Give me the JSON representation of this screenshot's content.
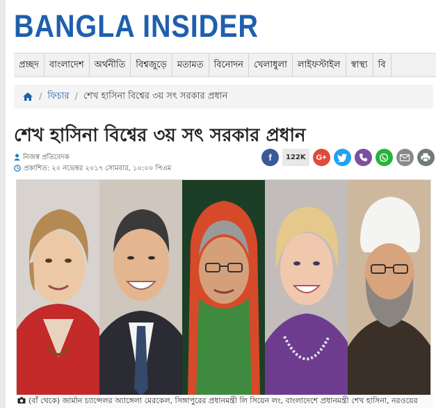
{
  "site": {
    "logo": "BANGLA INSIDER"
  },
  "nav": [
    "প্রচ্ছদ",
    "বাংলাদেশ",
    "অর্থনীতি",
    "বিশ্বজুড়ে",
    "মতামত",
    "বিনোদন",
    "খেলাধুলা",
    "লাইফস্টাইল",
    "স্বাস্থ্য",
    "বি"
  ],
  "breadcrumb": {
    "home_icon": "home-icon",
    "section": "ফিচার",
    "current": "শেখ হাসিনা বিশ্বের ৩য় সৎ সরকার প্রধান"
  },
  "article": {
    "title": "শেখ হাসিনা বিশ্বের ৩য় সৎ সরকার প্রধান",
    "author": "নিজস্ব প্রতিবেদক",
    "published": "প্রকাশিত: ২০ নভেম্বর ২০১৭ সোমবার, ১০:০০ পিএম",
    "caption": "(বাঁ থেকে) জার্মান চ্যান্সেলর অ্যাঙ্গেলা মেরকেল, সিঙ্গাপুরের প্রধানমন্ত্রী লি সিয়েন লং, বাংলাদেশে প্রধানমন্ত্রী শেখ হাসিনা, নরওয়ের"
  },
  "share": {
    "count": "122K",
    "buttons": [
      {
        "name": "facebook",
        "glyph": "f",
        "color": "#3b5998"
      },
      {
        "name": "google-plus",
        "glyph": "G+",
        "color": "#dd4b39"
      },
      {
        "name": "twitter",
        "glyph": "t",
        "color": "#1da1f2"
      },
      {
        "name": "viber",
        "glyph": "✆",
        "color": "#7b519d"
      },
      {
        "name": "whatsapp",
        "glyph": "✆",
        "color": "#25b43a"
      },
      {
        "name": "email",
        "glyph": "✉",
        "color": "#8a8a8a"
      },
      {
        "name": "print",
        "glyph": "⎙",
        "color": "#6f7b7a"
      }
    ]
  },
  "colors": {
    "brand": "#1f5fad",
    "link": "#1f5fad"
  }
}
